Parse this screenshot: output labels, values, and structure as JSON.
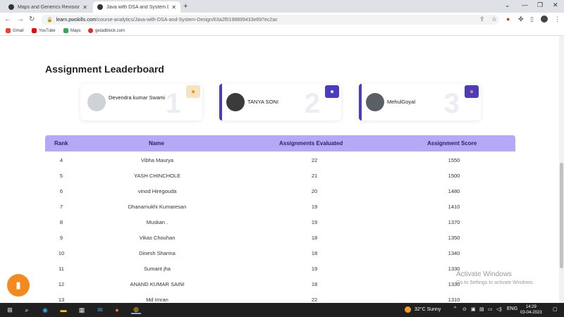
{
  "browser": {
    "tabs": [
      {
        "title": "Maps and Generics Revision Class",
        "close": "✕"
      },
      {
        "title": "Java with DSA and System Design",
        "close": "✕"
      }
    ],
    "new_tab": "+",
    "url_host": "learn.pwskills.com",
    "url_path": "/course-analytics/Java-with-DSA-and-System-Design/63a2f0198899433e697ec2ac",
    "bookmarks": [
      {
        "label": "Gmail",
        "color": "#ea4335"
      },
      {
        "label": "YouTube",
        "color": "#ff0000"
      },
      {
        "label": "Maps",
        "color": "#34a853"
      },
      {
        "label": "getadblock.com",
        "color": "#d93025"
      }
    ]
  },
  "leaderboard": {
    "title": "Assignment Leaderboard",
    "top": [
      {
        "name": "Devendra kumar Swami",
        "rank": "1",
        "badge_color": "#f7e3c0",
        "badge_icon": "medal-gold-icon"
      },
      {
        "name": "TANYA SONI",
        "rank": "2",
        "badge_color": "#4b3bbf",
        "badge_icon": "medal-silver-icon"
      },
      {
        "name": "MehulGoyal",
        "rank": "3",
        "badge_color": "#4b3bbf",
        "badge_icon": "medal-bronze-icon"
      }
    ],
    "columns": [
      "Rank",
      "Name",
      "Assignments Evaluated",
      "Assignment Score"
    ],
    "rows": [
      {
        "rank": "4",
        "name": "Vibha Maurya",
        "evaluated": "22",
        "score": "1550"
      },
      {
        "rank": "5",
        "name": "YASH CHINCHOLE",
        "evaluated": "21",
        "score": "1500"
      },
      {
        "rank": "6",
        "name": "vinod Hiregouda",
        "evaluated": "20",
        "score": "1480"
      },
      {
        "rank": "7",
        "name": "Dhanamukhi Kumaresan",
        "evaluated": "19",
        "score": "1410"
      },
      {
        "rank": "8",
        "name": "Muskan .",
        "evaluated": "19",
        "score": "1370"
      },
      {
        "rank": "9",
        "name": "Vikas Chouhan",
        "evaluated": "18",
        "score": "1350"
      },
      {
        "rank": "10",
        "name": "Dinesh Sharma",
        "evaluated": "18",
        "score": "1340"
      },
      {
        "rank": "11",
        "name": "Sumant jha",
        "evaluated": "19",
        "score": "1330"
      },
      {
        "rank": "12",
        "name": "ANAND KUMAR SAINI",
        "evaluated": "18",
        "score": "1330"
      },
      {
        "rank": "13",
        "name": "Md Imran",
        "evaluated": "22",
        "score": "1310"
      }
    ]
  },
  "watermark": {
    "line1": "Activate Windows",
    "line2": "Go to Settings to activate Windows."
  },
  "taskbar": {
    "weather": "32°C  Sunny",
    "lang": "ENG",
    "time": "14:29",
    "date": "03-04-2023"
  },
  "colors": {
    "accent": "#4b3bbf",
    "table_header": "#b4a9f7",
    "chat_button": "#f4891f"
  }
}
